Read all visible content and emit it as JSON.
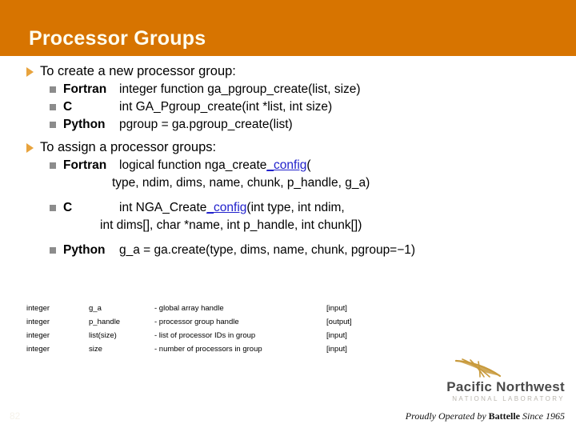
{
  "slide": {
    "title": "Processor Groups",
    "page_number": "82",
    "header_color": "#d77400",
    "title_color": "#fffff0",
    "bullet1_color": "#e8a33d",
    "bullet2_color": "#8c8c8c",
    "link_color": "#2222cc"
  },
  "sections": [
    {
      "heading": "To create a new processor group:",
      "items": [
        {
          "lang": "Fortran",
          "signature": "integer function ga_pgroup_create(list, size)"
        },
        {
          "lang": "C",
          "signature": "int GA_Pgroup_create(int *list, int size)"
        },
        {
          "lang": "Python",
          "signature": "pgroup = ga.pgroup_create(list)"
        }
      ]
    },
    {
      "heading": "To assign a processor groups:",
      "items": [
        {
          "lang": "Fortran",
          "sig_pre": "logical function nga_create",
          "sig_link": "_config",
          "sig_post": "(",
          "continuation": "type, ndim, dims, name, chunk, p_handle, g_a)"
        },
        {
          "lang": "C",
          "sig_pre": "int NGA_Create",
          "sig_link": "_config",
          "sig_post": "(int type, int ndim,",
          "continuation": "int dims[], char *name, int p_handle, int chunk[])"
        },
        {
          "lang": "Python",
          "signature": "g_a = ga.create(type, dims, name, chunk, pgroup=−1)"
        }
      ]
    }
  ],
  "param_table": {
    "rows": [
      {
        "type": "integer",
        "name": "g_a",
        "desc": "- global array handle",
        "io": "[input]"
      },
      {
        "type": "integer",
        "name": "p_handle",
        "desc": "- processor group handle",
        "io": "[output]"
      },
      {
        "type": "integer",
        "name": "list(size)",
        "desc": "- list of processor IDs in group",
        "io": "[input]"
      },
      {
        "type": "integer",
        "name": "size",
        "desc": "- number of processors in group",
        "io": "[input]"
      }
    ]
  },
  "footer": {
    "logo_name": "Pacific Northwest",
    "logo_sub": "NATIONAL LABORATORY",
    "tagline_pre": "Proudly Operated by ",
    "tagline_brand": "Battelle",
    "tagline_post": " Since 1965"
  }
}
